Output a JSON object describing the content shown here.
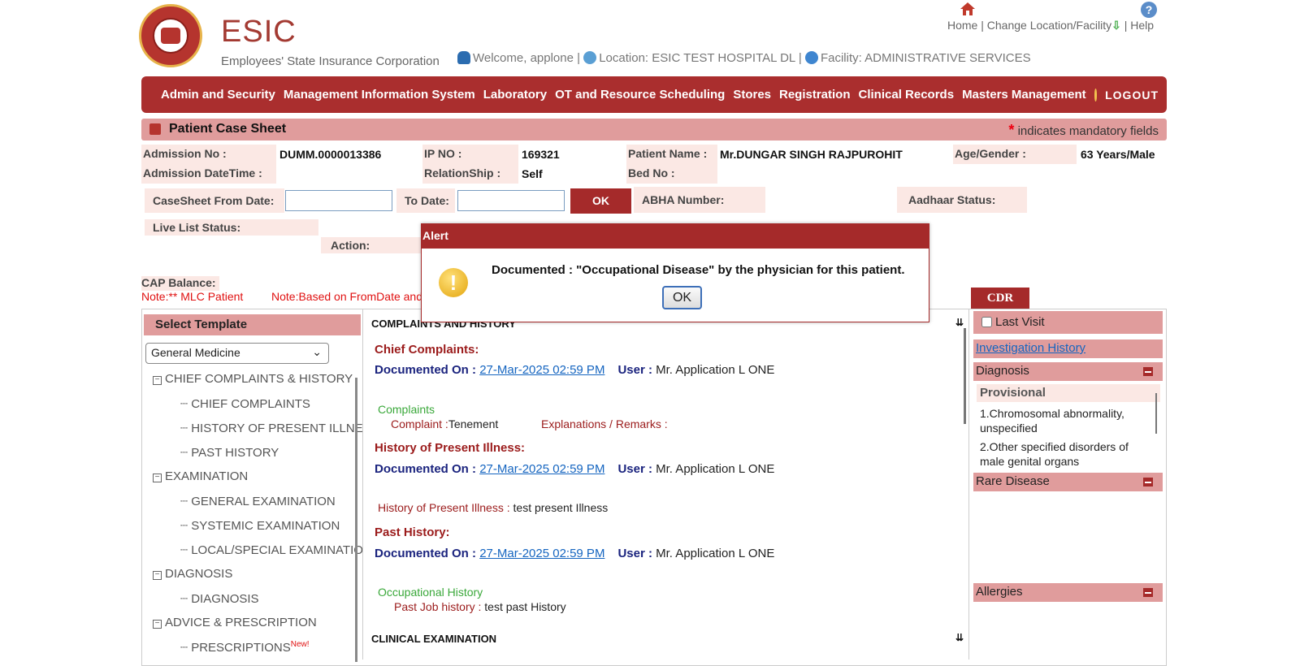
{
  "header": {
    "brand": "ESIC",
    "brand_subtitle": "Employees' State Insurance Corporation",
    "home_label": "Home",
    "change_location_label": "Change Location/Facility",
    "help_label": "Help",
    "welcome": "Welcome, applone",
    "location": "Location: ESIC TEST HOSPITAL DL",
    "facility": "Facility: ADMINISTRATIVE SERVICES",
    "separator": "|"
  },
  "nav": {
    "items": [
      "Admin and Security",
      "Management Information System",
      "Laboratory",
      "OT and Resource Scheduling",
      "Stores",
      "Registration",
      "Clinical Records",
      "Masters Management"
    ],
    "logout": "LOGOUT"
  },
  "titlebar": {
    "title": "Patient Case Sheet",
    "asterisk": "*",
    "mandatory_note": "indicates mandatory fields"
  },
  "patient": {
    "admission_no_label": "Admission No :",
    "admission_no": "DUMM.0000013386",
    "ip_no_label": "IP NO :",
    "ip_no": "169321",
    "patient_name_label": "Patient Name :",
    "patient_name": "Mr.DUNGAR SINGH RAJPUROHIT",
    "age_gender_label": "Age/Gender :",
    "age_gender": "63 Years/Male",
    "admission_datetime_label": "Admission DateTime :",
    "relationship_label": "RelationShip :",
    "relationship": "Self",
    "bed_no_label": "Bed No :",
    "casesheet_from_label": "CaseSheet From Date:",
    "to_date_label": "To Date:",
    "ok_label": "OK",
    "abha_label": "ABHA Number:",
    "aadhaar_label": "Aadhaar Status:",
    "live_list_label": "Live List Status:",
    "action_label": "Action:",
    "cap_balance_label": "CAP Balance:",
    "note_mlc": "Note:** MLC Patient",
    "note_based": "Note:Based on FromDate and"
  },
  "template": {
    "header": "Select Template",
    "selected": "General Medicine",
    "tree": {
      "g1": "CHIEF COMPLAINTS & HISTORY",
      "g1c1": "CHIEF COMPLAINTS",
      "g1c2": "HISTORY OF PRESENT ILLNE",
      "g1c3": "PAST HISTORY",
      "g2": "EXAMINATION",
      "g2c1": "GENERAL EXAMINATION",
      "g2c2": "SYSTEMIC EXAMINATION",
      "g2c3": "LOCAL/SPECIAL EXAMINATIO",
      "g3": "DIAGNOSIS",
      "g3c1": "DIAGNOSIS",
      "g4": "ADVICE & PRESCRIPTION",
      "g4c1": "PRESCRIPTIONS",
      "new_badge": "New!"
    }
  },
  "content": {
    "section1": "COMPLAINTS AND HISTORY",
    "chief_complaints": "Chief Complaints:",
    "documented_on_label": "Documented On :",
    "documented_date": "27-Mar-2025 02:59 PM",
    "user_label": "User :",
    "user": "Mr. Application L ONE",
    "complaints_h": "Complaints",
    "complaint_label": "Complaint :",
    "complaint_value": "Tenement",
    "explanations_label": "Explanations / Remarks :",
    "hpi_h": "History of Present Illness:",
    "hpi_label": "History of Present Illness :",
    "hpi_value": "test present Illness",
    "past_h": "Past History:",
    "occupational_h": "Occupational History",
    "past_job_label": "Past Job history :",
    "past_job_value": "test past History",
    "section2": "CLINICAL EXAMINATION"
  },
  "right_panel": {
    "cdr": "CDR",
    "last_visit": "Last Visit",
    "investigation_history": "Investigation History",
    "diagnosis": "Diagnosis",
    "provisional": "Provisional",
    "diag1": "1.Chromosomal abnormality, unspecified",
    "diag2": "2.Other specified disorders of male genital organs",
    "rare_disease": "Rare Disease",
    "allergies": "Allergies"
  },
  "alert": {
    "title": "Alert",
    "message": "Documented : \"Occupational Disease\" by the physician for this patient.",
    "ok": "OK"
  }
}
